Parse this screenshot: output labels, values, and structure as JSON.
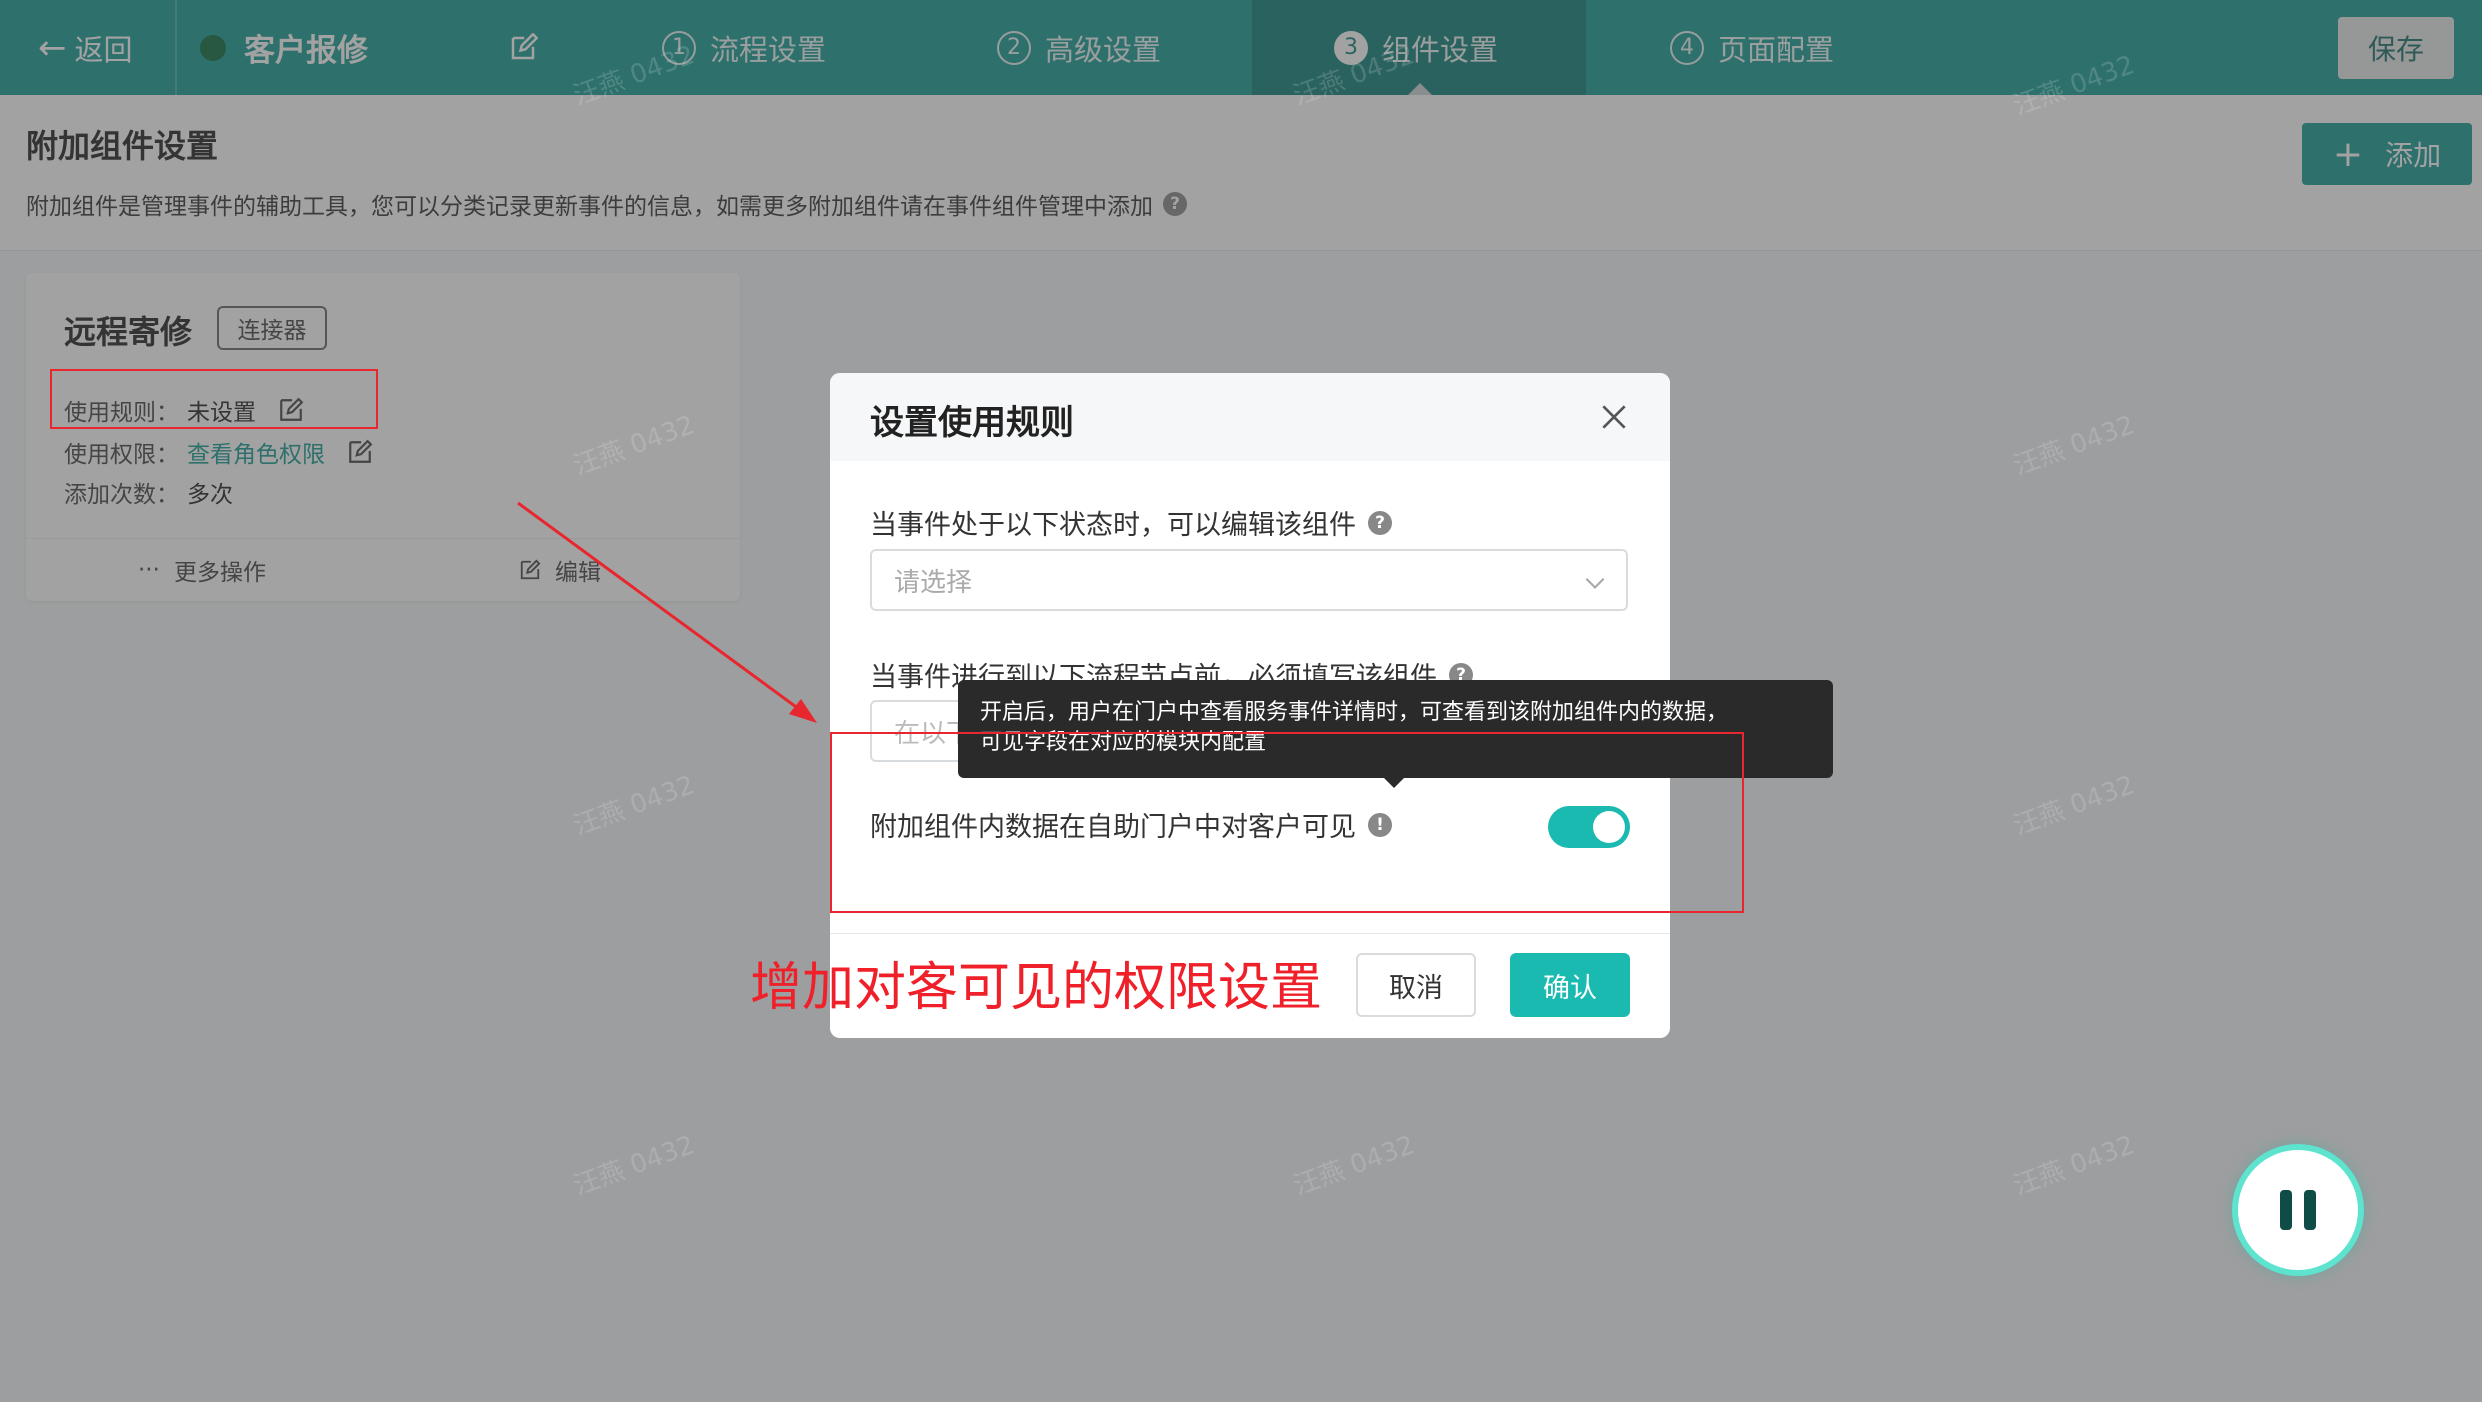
{
  "topbar": {
    "back_label": "返回",
    "app_title": "客户报修",
    "steps": [
      {
        "num": "1",
        "label": "流程设置",
        "active": false
      },
      {
        "num": "2",
        "label": "高级设置",
        "active": false
      },
      {
        "num": "3",
        "label": "组件设置",
        "active": true
      },
      {
        "num": "4",
        "label": "页面配置",
        "active": false
      }
    ],
    "save_label": "保存"
  },
  "page": {
    "title": "附加组件设置",
    "description": "附加组件是管理事件的辅助工具，您可以分类记录更新事件的信息，如需更多附加组件请在事件组件管理中添加",
    "add_label": "添加"
  },
  "card": {
    "title": "远程寄修",
    "tag": "连接器",
    "rows": [
      {
        "label": "使用规则：",
        "value": "未设置"
      },
      {
        "label": "使用权限：",
        "value": "查看角色权限"
      },
      {
        "label": "添加次数：",
        "value": "多次"
      }
    ],
    "more_label": "更多操作",
    "edit_label": "编辑"
  },
  "watermark": "汪燕 0432",
  "modal": {
    "title": "设置使用规则",
    "field1_label": "当事件处于以下状态时，可以编辑该组件",
    "field1_placeholder": "请选择",
    "field2_label": "当事件进行到以下流程节点前，必须填写该组件",
    "field2_placeholder": "在以下",
    "field3_label": "附加组件内数据在自助门户中对客户可见",
    "toggle_on": true,
    "cancel_label": "取消",
    "ok_label": "确认"
  },
  "tooltip": {
    "line1": "开启后，用户在门户中查看服务事件详情时，可查看到该附加组件内的数据，",
    "line2": "可见字段在对应的模块内配置"
  },
  "annotation": "增加对客可见的权限设置",
  "colors": {
    "brand": "#169b92",
    "toggle": "#1bbab0",
    "highlight_red": "#e8262e"
  }
}
